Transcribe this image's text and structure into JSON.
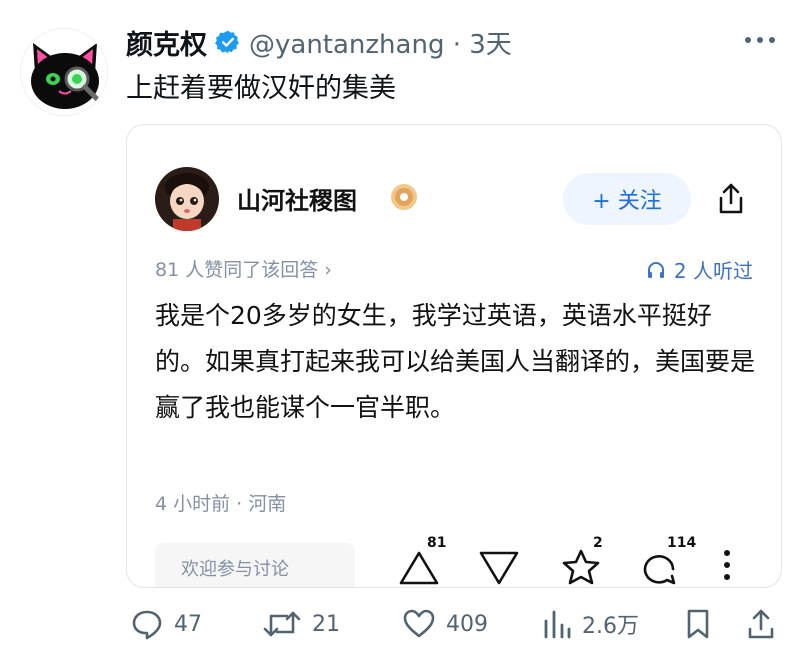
{
  "tweet": {
    "display_name": "颜克权",
    "handle_time": "@yantanzhang · 3天",
    "text": "上赶着要做汉奸的集美",
    "avatar_icon": "black-cat-magnifier-avatar",
    "verified_icon": "verified-badge-icon"
  },
  "card": {
    "author": "山河社稷图",
    "follow_label": "+ 关注",
    "approval_text": "81 人赞同了该回答 ›",
    "listen_text": "2 人听过",
    "answer_text": "我是个20多岁的女生，我学过英语，英语水平挺好的。如果真打起来我可以给美国人当翻译的，美国要是赢了我也能谋个一官半职。",
    "meta": "4 小时前 · 河南",
    "comment_placeholder": "欢迎参与讨论",
    "upvote_count": "81",
    "favorite_count": "2",
    "comment_count": "114"
  },
  "actions": {
    "replies": "47",
    "retweets": "21",
    "likes": "409",
    "views": "2.6万"
  },
  "colors": {
    "x_blue": "#1d9bf0",
    "zhihu_blue": "#1d6fe0",
    "secondary_text": "#536471"
  }
}
